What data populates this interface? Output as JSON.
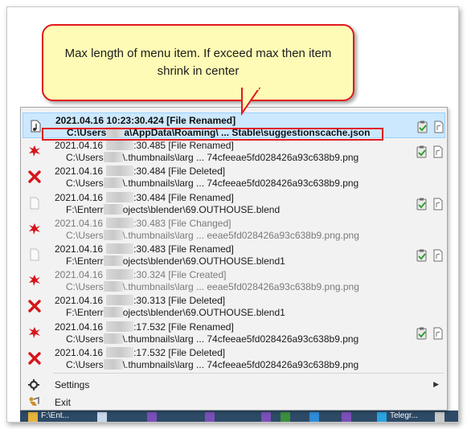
{
  "callout": {
    "text": "Max length of menu item. If exceed max then item shrink in center"
  },
  "menu": {
    "items": [
      {
        "line1": "2021.04.16 10:23:30.424 [File Renamed]",
        "line2": "C:\\Users",
        "line2b": "a\\AppData\\Roaming\\ ...  Stable\\suggestionscache.json",
        "icon": "music-file-icon",
        "selected": true
      },
      {
        "line1": "2021.04.16",
        "line1b": ":30.485 [File Renamed]",
        "line2": "C:\\Users",
        "line2b": "\\.thumbnails\\larg ... 74cfeeae5fd028426a93c638b9.png",
        "icon": "red-splat-icon"
      },
      {
        "line1": "2021.04.16",
        "line1b": ":30.484 [File Deleted]",
        "line2": "C:\\Users",
        "line2b": "\\.thumbnails\\larg ... 74cfeeae5fd028426a93c638b9.png",
        "icon": "red-x-icon"
      },
      {
        "line1": "2021.04.16",
        "line1b": ":30.484 [File Renamed]",
        "line2": "F:\\Enterr",
        "line2b": "ojects\\blender\\69.OUTHOUSE.blend",
        "icon": "blank-file-icon"
      },
      {
        "line1": "2021.04.16",
        "line1b": ":30.483 [File Changed]",
        "line2": "C:\\Users",
        "line2b": "\\.thumbnails\\larg ... eeae5fd028426a93c638b9.png.png",
        "icon": "red-splat-icon",
        "dim": true
      },
      {
        "line1": "2021.04.16",
        "line1b": ":30.483 [File Renamed]",
        "line2": "F:\\Enterr",
        "line2b": "ojects\\blender\\69.OUTHOUSE.blend1",
        "icon": "blank-file-icon"
      },
      {
        "line1": "2021.04.16",
        "line1b": ":30.324 [File Created]",
        "line2": "C:\\Users",
        "line2b": "\\.thumbnails\\larg ... eeae5fd028426a93c638b9.png.png",
        "icon": "red-splat-icon",
        "dim": true
      },
      {
        "line1": "2021.04.16",
        "line1b": ":30.313 [File Deleted]",
        "line2": "F:\\Enterr",
        "line2b": "ojects\\blender\\69.OUTHOUSE.blend1",
        "icon": "red-x-icon"
      },
      {
        "line1": "2021.04.16",
        "line1b": ":17.532 [File Renamed]",
        "line2": "C:\\Users",
        "line2b": "\\.thumbnails\\larg ... 74cfeeae5fd028426a93c638b9.png",
        "icon": "red-splat-icon"
      },
      {
        "line1": "2021.04.16",
        "line1b": ":17.532 [File Deleted]",
        "line2": "C:\\Users",
        "line2b": "\\.thumbnails\\larg ... 74cfeeae5fd028426a93c638b9.png",
        "icon": "red-x-icon"
      }
    ],
    "settings_label": "Settings",
    "exit_label": "Exit"
  },
  "taskbar": {
    "item_label": "F:\\Ent...",
    "telegram_label": "Telegr..."
  },
  "colors": {
    "highlight_border": "#e0191d",
    "callout_bg": "#fdfbb5",
    "selection_bg": "#cce8ff"
  }
}
